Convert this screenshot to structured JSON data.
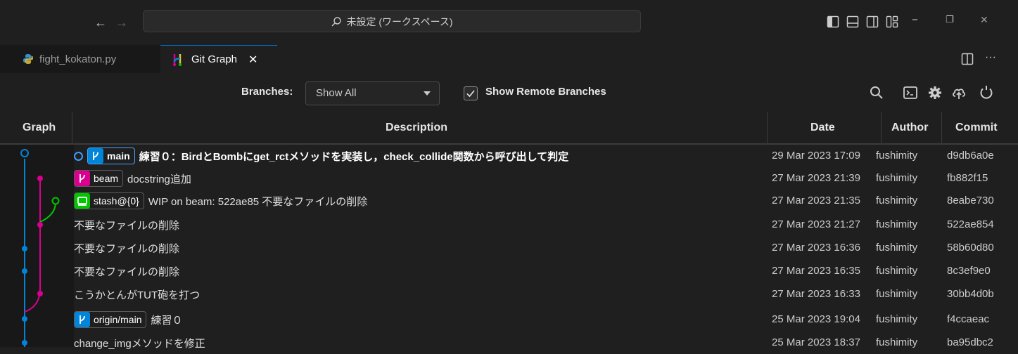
{
  "titlebar": {
    "back_arrow": "←",
    "forward_arrow": "→",
    "search_text": "未設定 (ワークスペース)",
    "minimize": "−",
    "restore": "❐",
    "close": "✕"
  },
  "tabs": [
    {
      "label": "fight_kokaton.py",
      "active": false,
      "icon": "python-icon"
    },
    {
      "label": "Git Graph",
      "active": true,
      "icon": "git-graph-icon",
      "close": "✕"
    }
  ],
  "tab_actions": {
    "more": "···"
  },
  "controls": {
    "branches_label": "Branches:",
    "branches_value": "Show All",
    "remote_label": "Show Remote Branches",
    "remote_checked": true
  },
  "columns": {
    "graph": "Graph",
    "description": "Description",
    "date": "Date",
    "author": "Author",
    "commit": "Commit"
  },
  "colors": {
    "main": "#0085d9",
    "beam": "#d9008f",
    "stash": "#00c600",
    "head": "#3f9bff"
  },
  "commits": [
    {
      "refs": [
        {
          "label": "main",
          "kind": "branch",
          "color": "#0085d9",
          "head": true
        }
      ],
      "message": "練習０：BirdとBombにget_rctメソッドを実装し，check_collide関数から呼び出して判定",
      "bold": true,
      "date": "29 Mar 2023 17:09",
      "author": "fushimity",
      "hash": "d9db6a0e"
    },
    {
      "refs": [
        {
          "label": "beam",
          "kind": "branch",
          "color": "#d9008f"
        }
      ],
      "message": "docstring追加",
      "date": "27 Mar 2023 21:39",
      "author": "fushimity",
      "hash": "fb882f15"
    },
    {
      "refs": [
        {
          "label": "stash@{0}",
          "kind": "stash",
          "color": "#00c600"
        }
      ],
      "message": "WIP on beam: 522ae85 不要なファイルの削除",
      "date": "27 Mar 2023 21:35",
      "author": "fushimity",
      "hash": "8eabe730"
    },
    {
      "refs": [],
      "message": "不要なファイルの削除",
      "date": "27 Mar 2023 21:27",
      "author": "fushimity",
      "hash": "522ae854"
    },
    {
      "refs": [],
      "message": "不要なファイルの削除",
      "date": "27 Mar 2023 16:36",
      "author": "fushimity",
      "hash": "58b60d80"
    },
    {
      "refs": [],
      "message": "不要なファイルの削除",
      "date": "27 Mar 2023 16:35",
      "author": "fushimity",
      "hash": "8c3ef9e0"
    },
    {
      "refs": [],
      "message": "こうかとんがTUT砲を打つ",
      "date": "27 Mar 2023 16:33",
      "author": "fushimity",
      "hash": "30bb4d0b"
    },
    {
      "refs": [
        {
          "label": "origin/main",
          "kind": "branch",
          "color": "#0085d9"
        }
      ],
      "message": "練習０",
      "date": "25 Mar 2023 19:04",
      "author": "fushimity",
      "hash": "f4ccaeac"
    },
    {
      "refs": [],
      "message": "change_imgメソッドを修正",
      "date": "25 Mar 2023 18:37",
      "author": "fushimity",
      "hash": "ba95dbc2"
    }
  ]
}
